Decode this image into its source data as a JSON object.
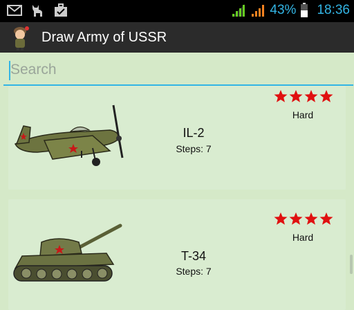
{
  "status_bar": {
    "battery_percent": "43%",
    "time": "18:36",
    "icons": [
      "mail-icon",
      "cat-icon",
      "briefcase-check-icon",
      "wifi-signal-icon",
      "cell-signal-icon",
      "battery-icon"
    ]
  },
  "action_bar": {
    "title": "Draw Army of USSR",
    "icon": "soldier-icon"
  },
  "search": {
    "placeholder": "Search"
  },
  "items": [
    {
      "name": "IL-2",
      "steps": "Steps: 7",
      "difficulty": "Hard",
      "stars": 4,
      "image": "airplane-icon"
    },
    {
      "name": "T-34",
      "steps": "Steps: 7",
      "difficulty": "Hard",
      "stars": 4,
      "image": "tank-icon"
    }
  ],
  "colors": {
    "accent": "#33b5e5",
    "star": "#e01010",
    "background": "#d5e9c8"
  }
}
